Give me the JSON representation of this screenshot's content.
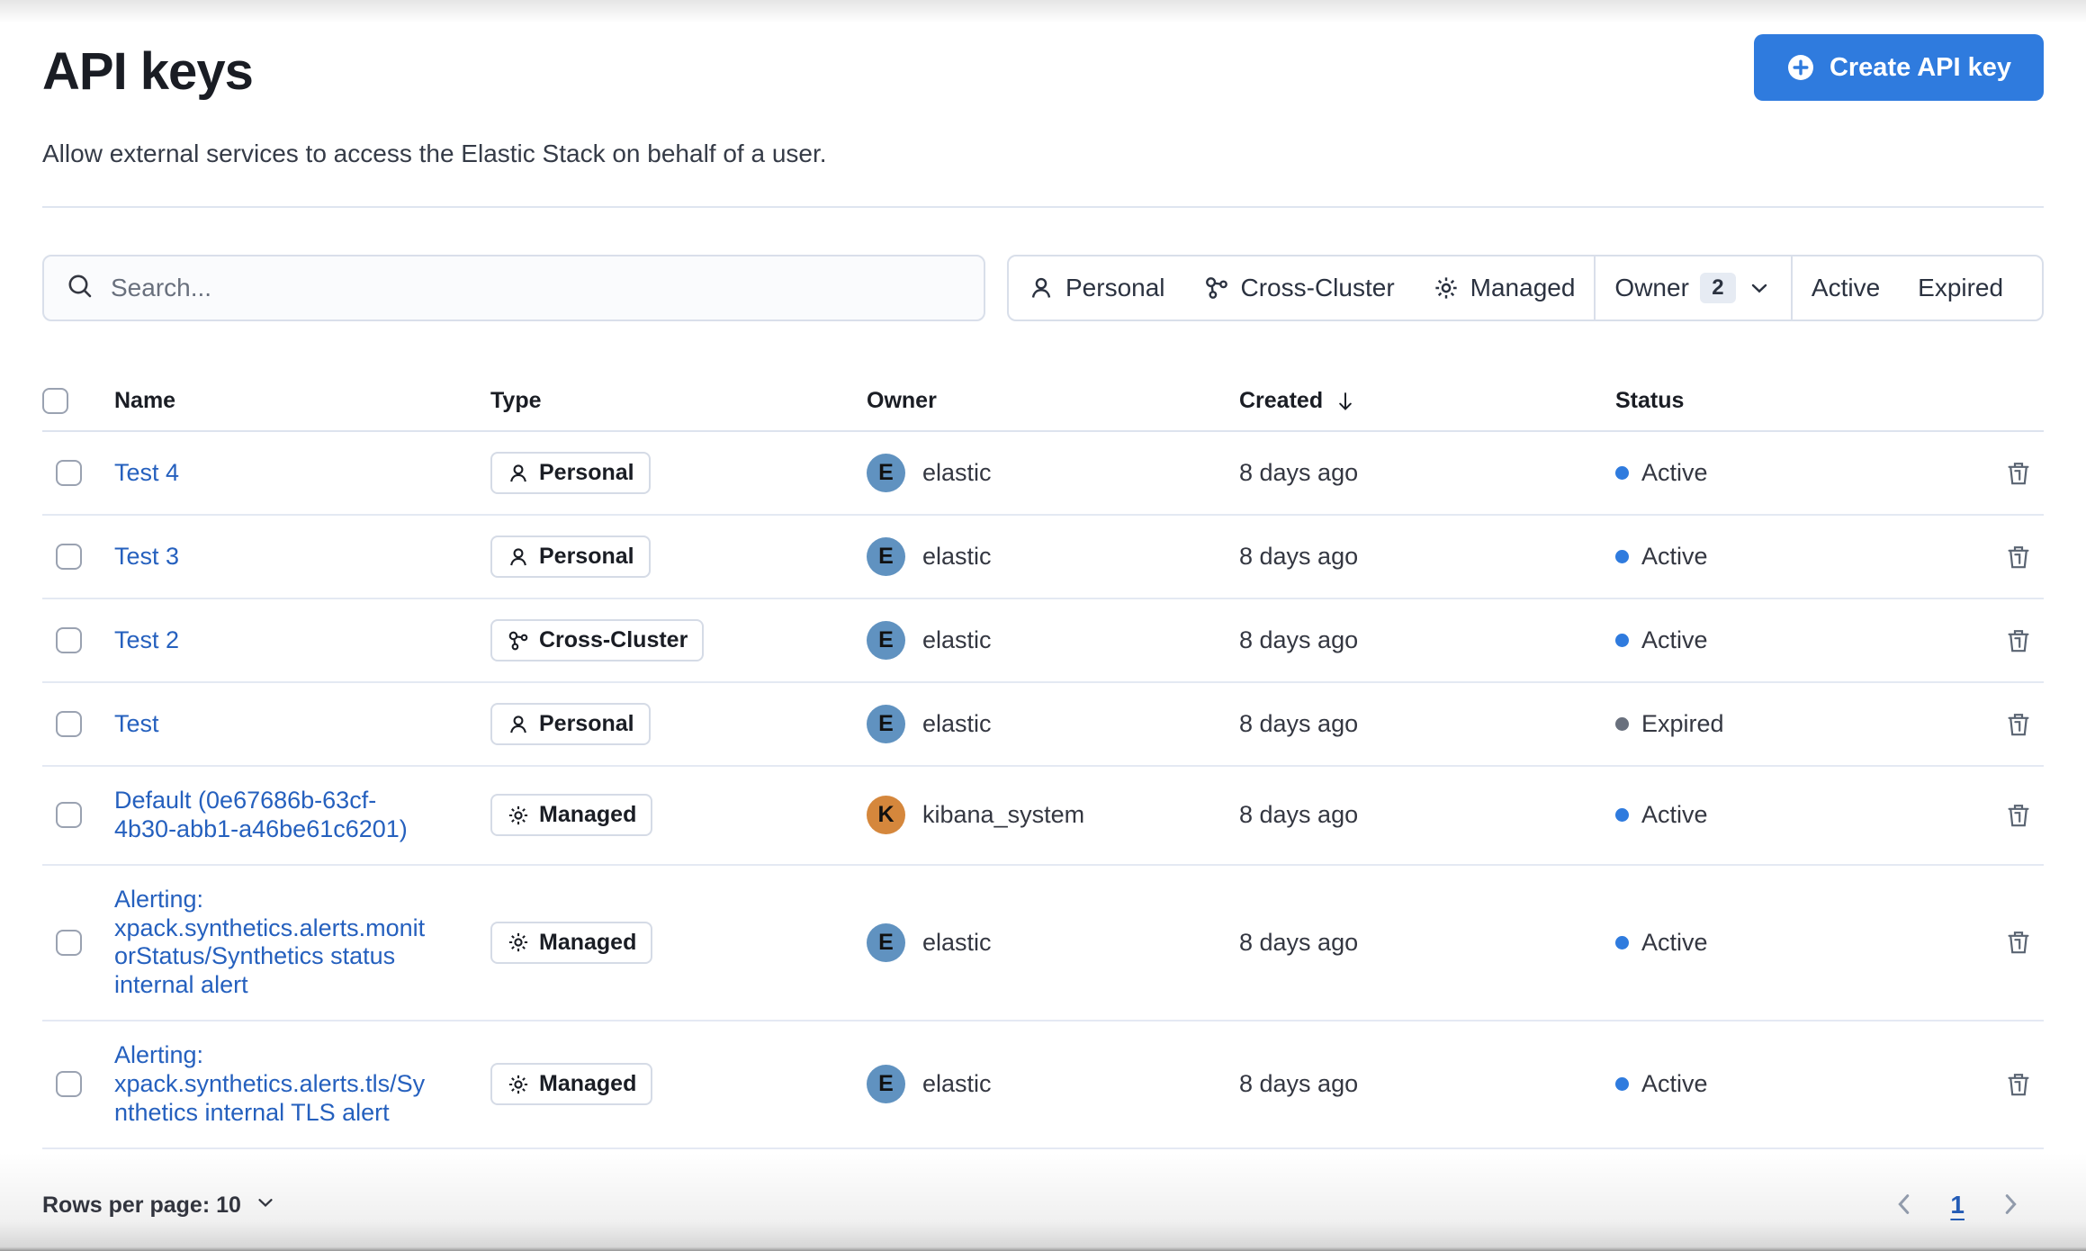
{
  "page": {
    "title": "API keys",
    "subtitle": "Allow external services to access the Elastic Stack on behalf of a user.",
    "create_button_label": "Create API key"
  },
  "toolbar": {
    "search_placeholder": "Search...",
    "filters": [
      {
        "label": "Personal",
        "icon": "user"
      },
      {
        "label": "Cross-Cluster",
        "icon": "cluster"
      },
      {
        "label": "Managed",
        "icon": "gear"
      },
      {
        "label": "Owner",
        "count": "2",
        "icon": "chevron-down"
      },
      {
        "label": "Active"
      },
      {
        "label": "Expired"
      }
    ]
  },
  "table": {
    "columns": [
      "Name",
      "Type",
      "Owner",
      "Created",
      "Status"
    ],
    "sorted_column": "Created",
    "sort_direction": "descending",
    "status_colors": {
      "Active": "#2F7BDE",
      "Expired": "#69707D"
    },
    "rows": [
      {
        "name": "Test 4",
        "type": "Personal",
        "type_icon": "user",
        "owner": "elastic",
        "owner_initial": "E",
        "avatar_color": "#6092C0",
        "created": "8 days ago",
        "status": "Active"
      },
      {
        "name": "Test 3",
        "type": "Personal",
        "type_icon": "user",
        "owner": "elastic",
        "owner_initial": "E",
        "avatar_color": "#6092C0",
        "created": "8 days ago",
        "status": "Active"
      },
      {
        "name": "Test 2",
        "type": "Cross-Cluster",
        "type_icon": "cluster",
        "owner": "elastic",
        "owner_initial": "E",
        "avatar_color": "#6092C0",
        "created": "8 days ago",
        "status": "Active"
      },
      {
        "name": "Test",
        "type": "Personal",
        "type_icon": "user",
        "owner": "elastic",
        "owner_initial": "E",
        "avatar_color": "#6092C0",
        "created": "8 days ago",
        "status": "Expired"
      },
      {
        "name": "Default (0e67686b-63cf-4b30-abb1-a46be61c6201)",
        "type": "Managed",
        "type_icon": "gear",
        "owner": "kibana_system",
        "owner_initial": "K",
        "avatar_color": "#D5873C",
        "created": "8 days ago",
        "status": "Active"
      },
      {
        "name": "Alerting: xpack.synthetics.alerts.monitorStatus/Synthetics status internal alert",
        "type": "Managed",
        "type_icon": "gear",
        "owner": "elastic",
        "owner_initial": "E",
        "avatar_color": "#6092C0",
        "created": "8 days ago",
        "status": "Active"
      },
      {
        "name": "Alerting: xpack.synthetics.alerts.tls/Synthetics internal TLS alert",
        "type": "Managed",
        "type_icon": "gear",
        "owner": "elastic",
        "owner_initial": "E",
        "avatar_color": "#6092C0",
        "created": "8 days ago",
        "status": "Active"
      }
    ]
  },
  "footer": {
    "rows_per_page_label": "Rows per page: 10",
    "current_page": "1"
  },
  "colors": {
    "primary": "#2F7BDE",
    "link": "#2560BE",
    "active_dot": "#2F7BDE",
    "expired_dot": "#69707D"
  }
}
